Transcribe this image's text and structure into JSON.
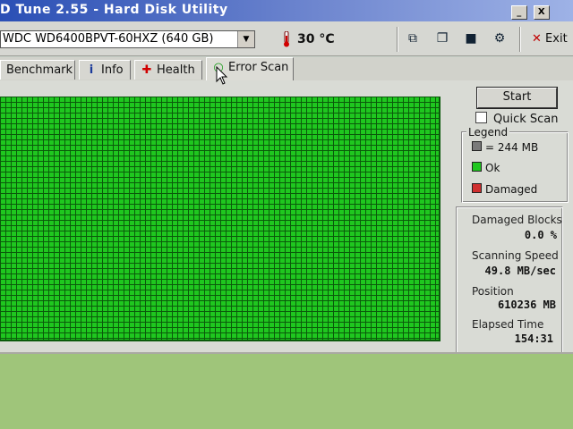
{
  "window": {
    "title": "D Tune 2.55 - Hard Disk Utility",
    "minimize_label": "_",
    "close_label": "X"
  },
  "toolbar": {
    "drive_value": "WDC WD6400BPVT-60HXZ (640 GB)",
    "temperature": "30 °C",
    "icons": [
      "copy-info-icon",
      "copy-screenshot-icon",
      "save-icon",
      "options-icon"
    ],
    "exit_label": "Exit"
  },
  "tabs": [
    {
      "label": "Benchmark",
      "icon": "benchmark-icon"
    },
    {
      "label": "Info",
      "icon": "info-icon"
    },
    {
      "label": "Health",
      "icon": "health-icon"
    },
    {
      "label": "Error Scan",
      "icon": "error-scan-icon",
      "active": true
    }
  ],
  "scan": {
    "start_label": "Start",
    "quick_scan_label": "Quick Scan",
    "quick_scan_checked": false,
    "block_status": "ok",
    "block_color": "#1fc71f"
  },
  "legend": {
    "title": "Legend",
    "items": [
      {
        "label": "= 244 MB",
        "color": "#7a7a7a"
      },
      {
        "label": "Ok",
        "color": "#1fc71f"
      },
      {
        "label": "Damaged",
        "color": "#d03030"
      }
    ]
  },
  "stats": {
    "damaged_blocks_label": "Damaged Blocks",
    "damaged_blocks_value": "0.0 %",
    "scanning_speed_label": "Scanning Speed",
    "scanning_speed_value": "49.8 MB/sec",
    "position_label": "Position",
    "position_value": "610236 MB",
    "elapsed_time_label": "Elapsed Time",
    "elapsed_time_value": "154:31"
  }
}
